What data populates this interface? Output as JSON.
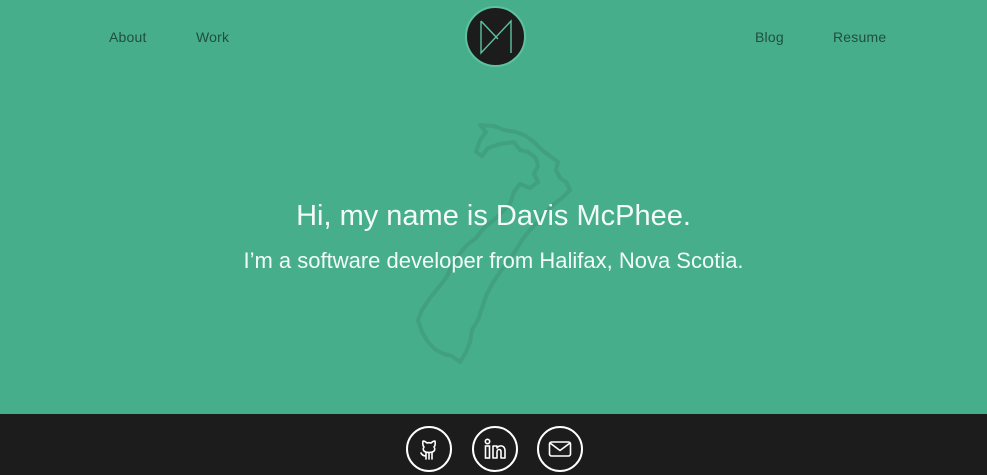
{
  "nav": {
    "about": "About",
    "work": "Work",
    "blog": "Blog",
    "resume": "Resume"
  },
  "logo": {
    "icon": "dm-monogram-logo"
  },
  "hero": {
    "title": "Hi, my name is Davis McPhee.",
    "subtitle": "I’m a software developer from Halifax, Nova Scotia."
  },
  "footer": {
    "social": [
      {
        "icon": "github-icon"
      },
      {
        "icon": "linkedin-icon"
      },
      {
        "icon": "email-icon"
      }
    ]
  },
  "colors": {
    "background": "#47ae8b",
    "footer": "#1c1c1c",
    "logo_stroke": "#5cc39e",
    "text_light": "#f2fbf7",
    "nav_text": "#1f4f3e"
  }
}
